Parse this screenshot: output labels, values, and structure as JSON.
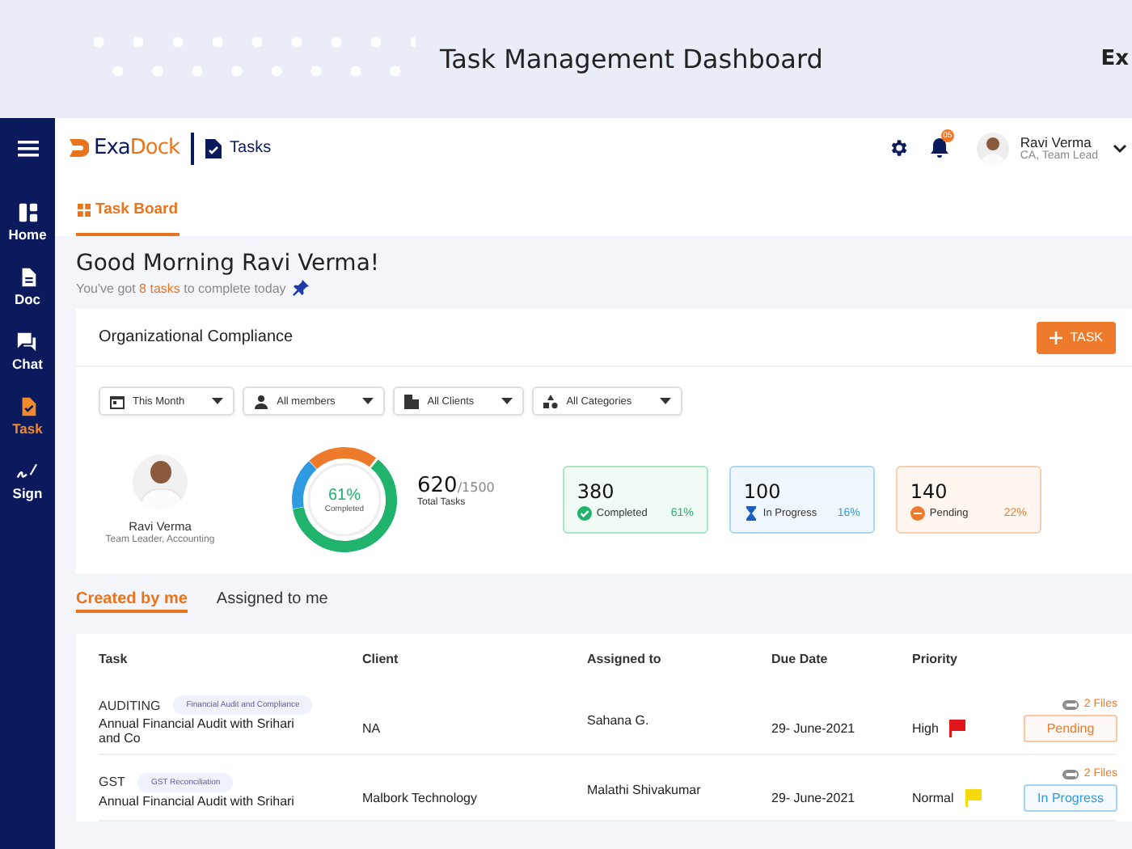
{
  "banner": {
    "title": "Task Management Dashboard",
    "side_text": "Ex"
  },
  "sidebar": {
    "items": [
      {
        "label": "Home",
        "kind": "home",
        "selected": false
      },
      {
        "label": "Doc",
        "kind": "doc",
        "selected": false
      },
      {
        "label": "Chat",
        "kind": "chat",
        "selected": false
      },
      {
        "label": "Task",
        "kind": "task",
        "selected": true
      },
      {
        "label": "Sign",
        "kind": "sign",
        "selected": false
      }
    ]
  },
  "header": {
    "logo": {
      "first": "Exa",
      "second": "Dock"
    },
    "section": "Tasks",
    "notifications": "05",
    "user": {
      "name": "Ravi Verma",
      "role": "CA, Team Lead"
    }
  },
  "tabs": [
    {
      "label": "Task Board",
      "selected": true
    }
  ],
  "greeting": {
    "title": "Good Morning Ravi Verma!",
    "before": "You've got",
    "count": "8 tasks",
    "after": "to complete today"
  },
  "compliance": {
    "title": "Organizational Compliance",
    "add_button": "TASK",
    "filters": [
      {
        "label": "This Month",
        "kind": "calendar"
      },
      {
        "label": "All members",
        "kind": "person"
      },
      {
        "label": "All Clients",
        "kind": "building"
      },
      {
        "label": "All Categories",
        "kind": "shapes"
      }
    ],
    "profile": {
      "name": "Ravi Verma",
      "role": "Team Leader, Accounting"
    },
    "donut": {
      "percent": "61%",
      "label": "Completed"
    },
    "total": {
      "value": "620",
      "of": "/1500",
      "label": "Total Tasks"
    },
    "stats": [
      {
        "kind": "completed",
        "value": "380",
        "label": "Completed",
        "percent": "61%"
      },
      {
        "kind": "in_progress",
        "value": "100",
        "label": "In Progress",
        "percent": "16%"
      },
      {
        "kind": "pending",
        "value": "140",
        "label": "Pending",
        "percent": "22%"
      }
    ]
  },
  "list_tabs": [
    {
      "label": "Created by me",
      "selected": true
    },
    {
      "label": "Assigned to me",
      "selected": false
    }
  ],
  "table": {
    "columns": [
      "Task",
      "Client",
      "Assigned to",
      "Due Date",
      "Priority"
    ],
    "rows": [
      {
        "category": "AUDITING",
        "tag": "Financial Audit and Compliance",
        "title": "Annual Financial Audit with Srihari and Co",
        "client": "NA",
        "assigned_to": "Sahana G.",
        "due_date": "29- June-2021",
        "priority": "High",
        "color": "#e0161b",
        "files": "2 Files",
        "status": {
          "label": "Pending",
          "color": "#ee7a2b"
        }
      },
      {
        "category": "GST",
        "tag": "GST Reconciliation",
        "title": "Annual Financial Audit with Srihari",
        "client": "Malbork Technology",
        "assigned_to": "Malathi Shivakumar",
        "due_date": "29- June-2021",
        "priority": "Normal",
        "color": "#f5d90a",
        "files": "2 Files",
        "status": {
          "label": "In Progress",
          "color": "#2e9be0"
        }
      }
    ]
  }
}
